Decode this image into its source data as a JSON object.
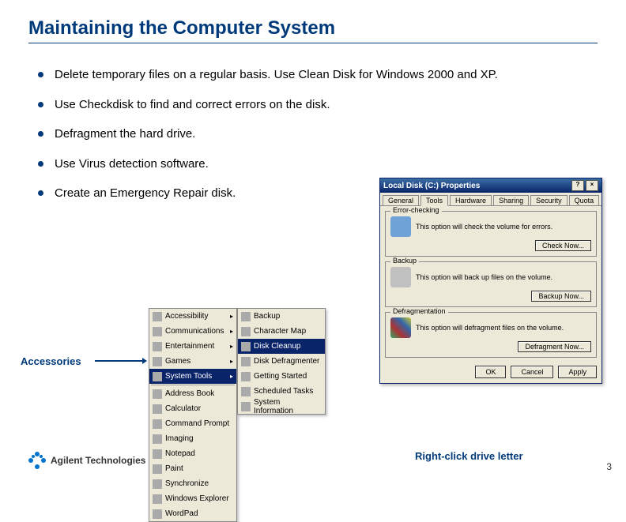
{
  "title": "Maintaining the Computer System",
  "bullets": [
    "Delete temporary files on a regular basis.  Use Clean Disk for Windows 2000 and XP.",
    "Use Checkdisk to find and correct errors on the disk.",
    "Defragment the hard drive.",
    "Use Virus detection software.",
    "Create an Emergency Repair disk."
  ],
  "accessories_label": "Accessories",
  "rclick_label": "Right-click drive letter",
  "logo_text": "Agilent Technologies",
  "page_number": "3",
  "menu1": {
    "items": [
      {
        "label": "Accessibility",
        "arrow": true
      },
      {
        "label": "Communications",
        "arrow": true
      },
      {
        "label": "Entertainment",
        "arrow": true
      },
      {
        "label": "Games",
        "arrow": true
      },
      {
        "label": "System Tools",
        "arrow": true,
        "selected": true
      },
      {
        "label": "Address Book"
      },
      {
        "label": "Calculator"
      },
      {
        "label": "Command Prompt"
      },
      {
        "label": "Imaging"
      },
      {
        "label": "Notepad"
      },
      {
        "label": "Paint"
      },
      {
        "label": "Synchronize"
      },
      {
        "label": "Windows Explorer"
      },
      {
        "label": "WordPad"
      }
    ]
  },
  "menu2": {
    "items": [
      {
        "label": "Backup"
      },
      {
        "label": "Character Map"
      },
      {
        "label": "Disk Cleanup",
        "selected": true
      },
      {
        "label": "Disk Defragmenter"
      },
      {
        "label": "Getting Started"
      },
      {
        "label": "Scheduled Tasks"
      },
      {
        "label": "System Information"
      }
    ]
  },
  "dialog": {
    "title": "Local Disk (C:) Properties",
    "tabs": [
      "General",
      "Tools",
      "Hardware",
      "Sharing",
      "Security",
      "Quota"
    ],
    "active_tab": "Tools",
    "errorchecking": {
      "title": "Error-checking",
      "text": "This option will check the volume for errors.",
      "button": "Check Now..."
    },
    "backup": {
      "title": "Backup",
      "text": "This option will back up files on the volume.",
      "button": "Backup Now..."
    },
    "defrag": {
      "title": "Defragmentation",
      "text": "This option will defragment files on the volume.",
      "button": "Defragment Now..."
    },
    "buttons": {
      "ok": "OK",
      "cancel": "Cancel",
      "apply": "Apply"
    }
  }
}
